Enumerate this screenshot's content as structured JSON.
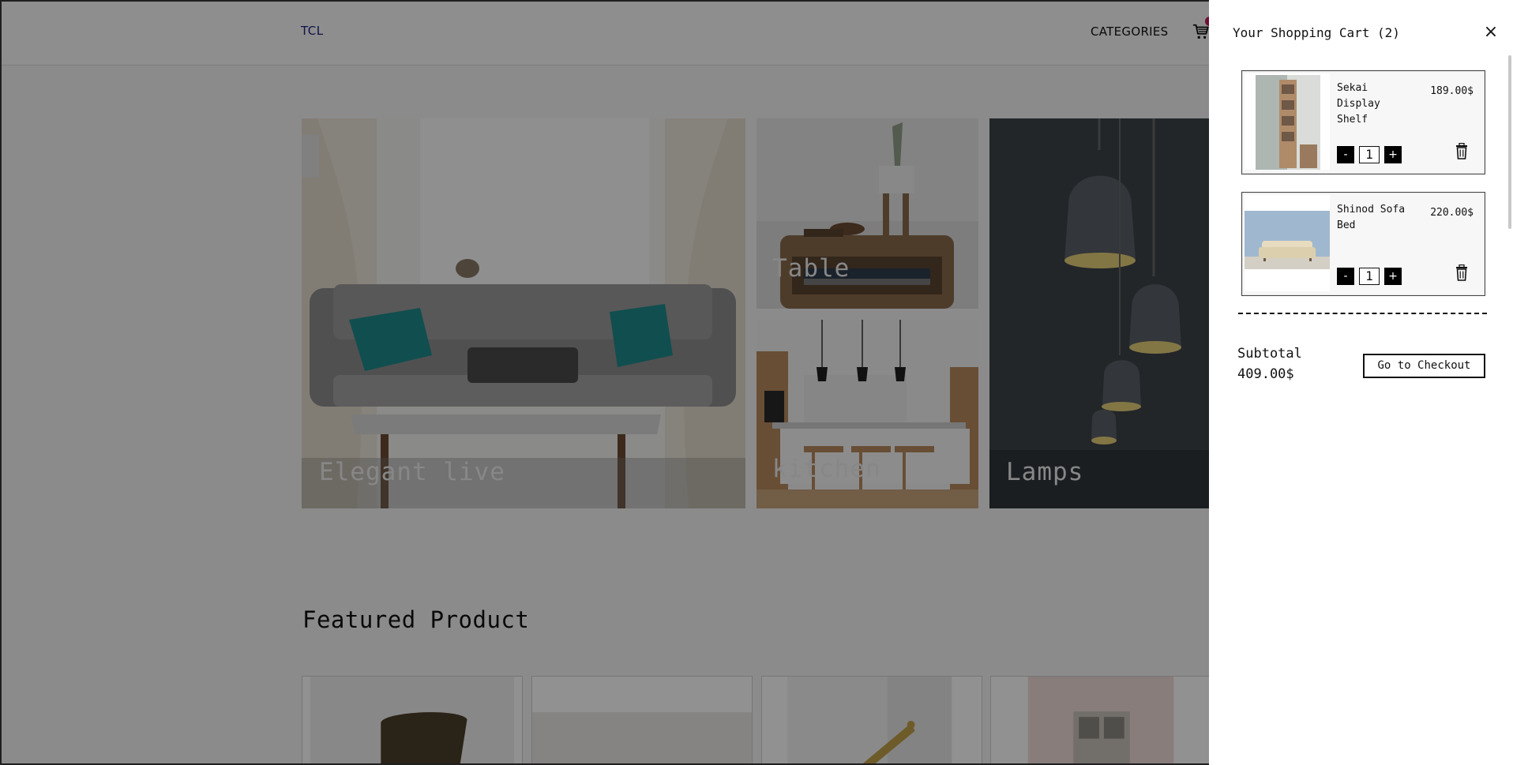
{
  "header": {
    "logo": "TCL",
    "nav_categories": "CATEGORIES",
    "cart_icon": "cart-icon"
  },
  "hero": {
    "tiles": [
      {
        "label": "Elegant live"
      },
      {
        "label": "Table"
      },
      {
        "label": "kitchen"
      },
      {
        "label": "Lamps"
      }
    ]
  },
  "featured": {
    "title": "Featured Product"
  },
  "cart": {
    "title": "Your Shopping Cart (2)",
    "close_icon": "close-icon",
    "items": [
      {
        "name": "Sekai Display Shelf",
        "price": "189.00$",
        "qty": "1",
        "minus": "-",
        "plus": "+"
      },
      {
        "name": "Shinod Sofa Bed",
        "price": "220.00$",
        "qty": "1",
        "minus": "-",
        "plus": "+"
      }
    ],
    "subtotal_label": "Subtotal",
    "subtotal_value": "409.00$",
    "checkout_label": "Go to Checkout"
  },
  "colors": {
    "overlay": "#000000",
    "badge": "#c2185b",
    "logo": "#1a237e"
  }
}
